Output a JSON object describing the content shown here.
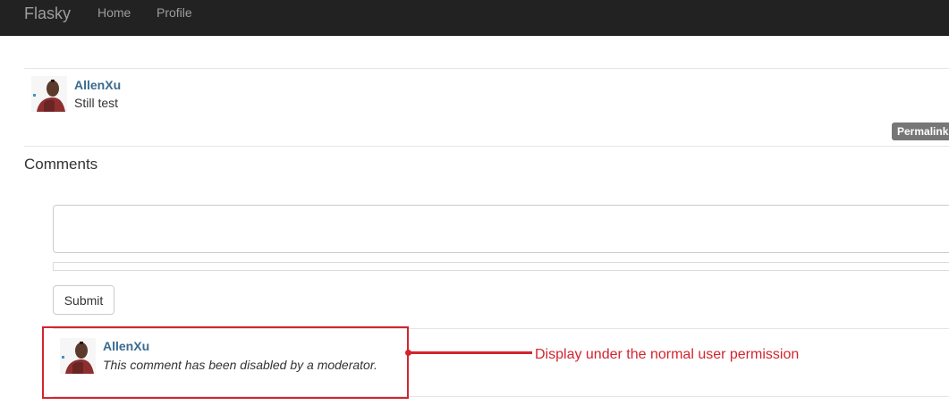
{
  "navbar": {
    "brand": "Flasky",
    "links": [
      "Home",
      "Profile"
    ]
  },
  "post": {
    "author": "AllenXu",
    "body": "Still test",
    "permalink": "Permalink"
  },
  "comments": {
    "title": "Comments",
    "form": {
      "textarea_value": "",
      "submit_label": "Submit"
    },
    "items": [
      {
        "author": "AllenXu",
        "body": "This comment has been disabled by a moderator."
      }
    ]
  },
  "annotation": {
    "text": "Display under the normal user permission",
    "color": "#d3242e"
  },
  "colors": {
    "navbar_bg": "#222222",
    "link_text": "#3a6b8f",
    "badge_bg": "#777777"
  }
}
